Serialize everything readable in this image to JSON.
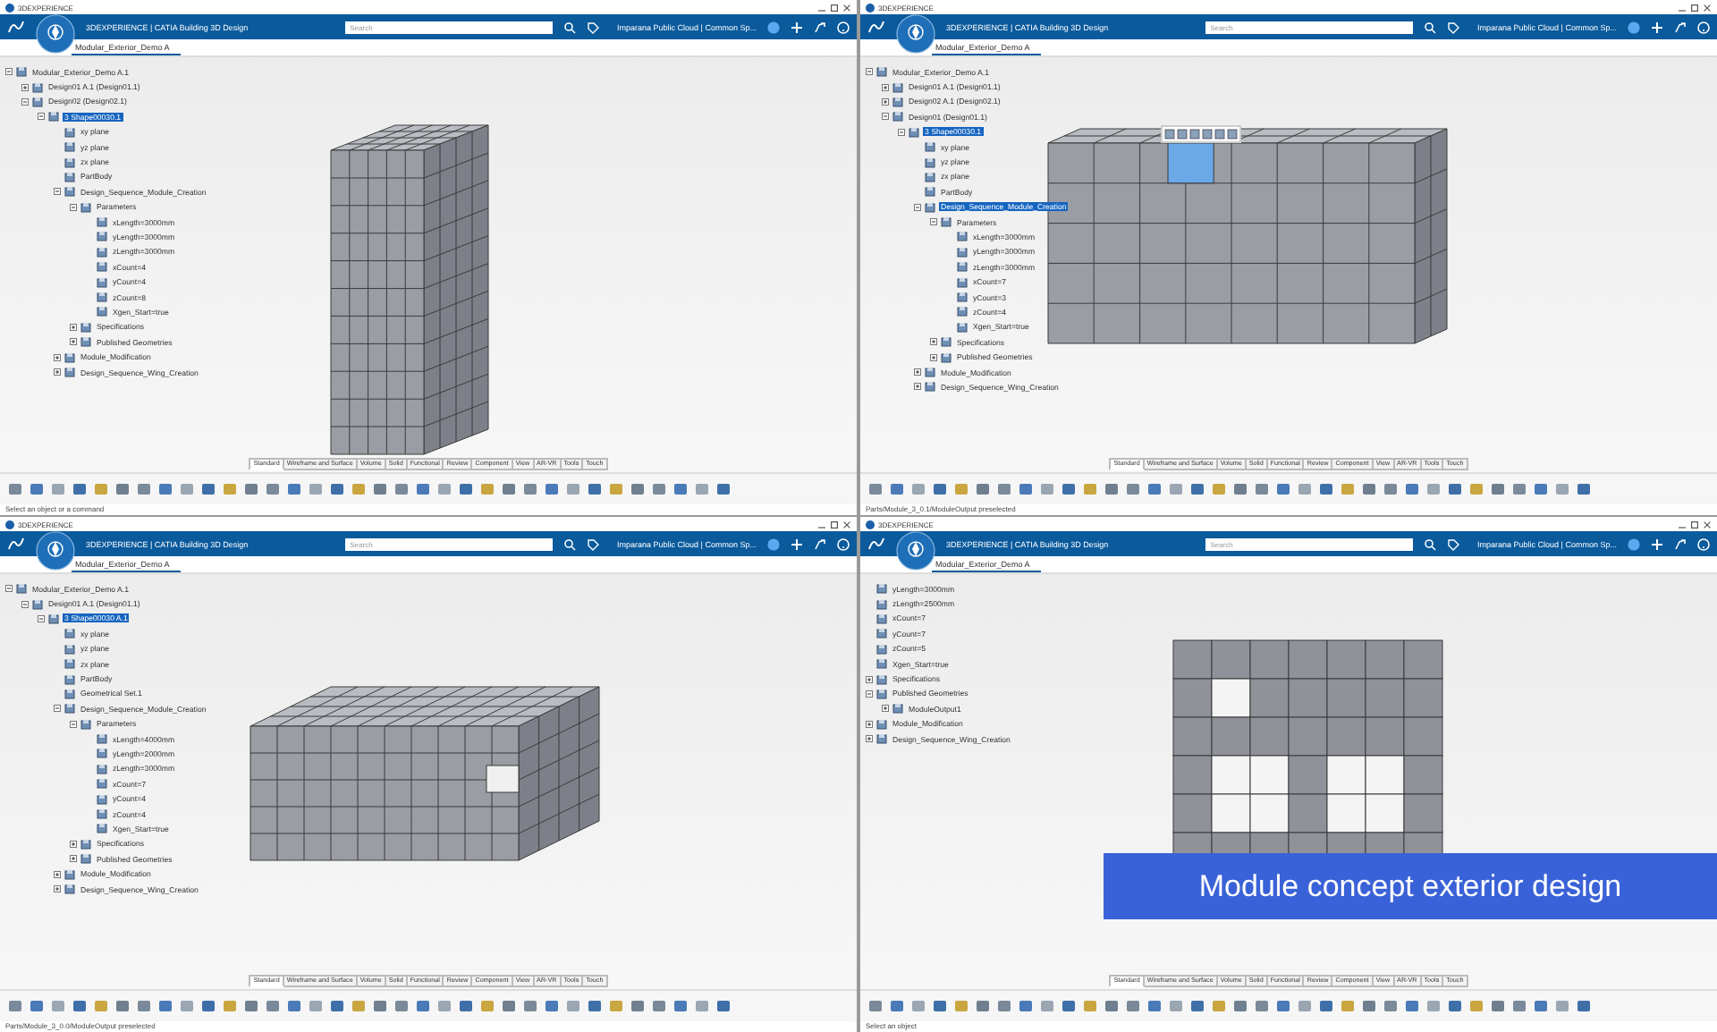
{
  "panes": [
    {
      "window_title": "3DEXPERIENCE",
      "app_title": "3DEXPERIENCE | CATIA Building 3D Design",
      "search": {
        "placeholder": "Search"
      },
      "cloud": "Imparana Public Cloud | Common Sp...",
      "doc_tab": "Modular_Exterior_Demo A",
      "model": {
        "kind": "tower"
      },
      "status": "Select an object or a command",
      "tree": [
        {
          "label": "Modular_Exterior_Demo A.1",
          "selected": false,
          "expanded": true,
          "children": [
            {
              "label": "Design01 A.1 (Design01.1)",
              "selected": false,
              "expanded": false
            },
            {
              "label": "Design02 (Design02.1)",
              "selected": false,
              "expanded": true,
              "children": [
                {
                  "label": "3 Shape00030.1",
                  "selected": true,
                  "expanded": true,
                  "children": [
                    {
                      "label": "xy plane",
                      "selected": false
                    },
                    {
                      "label": "yz plane",
                      "selected": false
                    },
                    {
                      "label": "zx plane",
                      "selected": false
                    },
                    {
                      "label": "PartBody",
                      "selected": false
                    },
                    {
                      "label": "Design_Sequence_Module_Creation",
                      "selected": false,
                      "expanded": true,
                      "children": [
                        {
                          "label": "Parameters",
                          "selected": false,
                          "expanded": true,
                          "children": [
                            {
                              "label": "xLength=3000mm",
                              "selected": false
                            },
                            {
                              "label": "yLength=3000mm",
                              "selected": false
                            },
                            {
                              "label": "zLength=3000mm",
                              "selected": false
                            },
                            {
                              "label": "xCount=4",
                              "selected": false
                            },
                            {
                              "label": "yCount=4",
                              "selected": false
                            },
                            {
                              "label": "zCount=8",
                              "selected": false
                            },
                            {
                              "label": "Xgen_Start=true",
                              "selected": false
                            }
                          ]
                        },
                        {
                          "label": "Specifications",
                          "selected": false,
                          "expanded": false
                        },
                        {
                          "label": "Published Geometries",
                          "selected": false,
                          "expanded": false
                        }
                      ]
                    },
                    {
                      "label": "Module_Modification",
                      "selected": false,
                      "expanded": false
                    },
                    {
                      "label": "Design_Sequence_Wing_Creation",
                      "selected": false,
                      "expanded": false
                    }
                  ]
                }
              ]
            }
          ]
        }
      ],
      "section_tabs": [
        {
          "label": "Standard",
          "selected": true
        },
        {
          "label": "Wireframe and Surface",
          "selected": false
        },
        {
          "label": "Volume",
          "selected": false
        },
        {
          "label": "Solid",
          "selected": false
        },
        {
          "label": "Functional",
          "selected": false
        },
        {
          "label": "Review",
          "selected": false
        },
        {
          "label": "Component",
          "selected": false
        },
        {
          "label": "View",
          "selected": false
        },
        {
          "label": "AR-VR",
          "selected": false
        },
        {
          "label": "Tools",
          "selected": false
        },
        {
          "label": "Touch",
          "selected": false
        }
      ]
    },
    {
      "window_title": "3DEXPERIENCE",
      "app_title": "3DEXPERIENCE | CATIA Building 3D Design",
      "search": {
        "placeholder": "Search"
      },
      "cloud": "Imparana Public Cloud | Common Sp...",
      "doc_tab": "Modular_Exterior_Demo A",
      "model": {
        "kind": "wall"
      },
      "status": "Parts/Module_3_0.1/ModuleOutput preselected",
      "tree": [
        {
          "label": "Modular_Exterior_Demo A.1",
          "selected": false,
          "expanded": true,
          "children": [
            {
              "label": "Design01 A.1 (Design01.1)",
              "selected": false,
              "expanded": false
            },
            {
              "label": "Design02 A.1 (Design02.1)",
              "selected": false,
              "expanded": false
            },
            {
              "label": "Design01 (Design01.1)",
              "selected": false,
              "expanded": true,
              "children": [
                {
                  "label": "3 Shape00030.1",
                  "selected": true,
                  "expanded": true,
                  "children": [
                    {
                      "label": "xy plane",
                      "selected": false
                    },
                    {
                      "label": "yz plane",
                      "selected": false
                    },
                    {
                      "label": "zx plane",
                      "selected": false
                    },
                    {
                      "label": "PartBody",
                      "selected": false
                    },
                    {
                      "label": "Design_Sequence_Module_Creation",
                      "selected": true,
                      "expanded": true,
                      "children": [
                        {
                          "label": "Parameters",
                          "selected": false,
                          "expanded": true,
                          "children": [
                            {
                              "label": "xLength=3000mm",
                              "selected": false
                            },
                            {
                              "label": "yLength=3000mm",
                              "selected": false
                            },
                            {
                              "label": "zLength=3000mm",
                              "selected": false
                            },
                            {
                              "label": "xCount=7",
                              "selected": false
                            },
                            {
                              "label": "yCount=3",
                              "selected": false
                            },
                            {
                              "label": "zCount=4",
                              "selected": false
                            },
                            {
                              "label": "Xgen_Start=true",
                              "selected": false
                            }
                          ]
                        },
                        {
                          "label": "Specifications",
                          "selected": false,
                          "expanded": false
                        },
                        {
                          "label": "Published Geometries",
                          "selected": false,
                          "expanded": false
                        }
                      ]
                    },
                    {
                      "label": "Module_Modification",
                      "selected": false,
                      "expanded": false
                    },
                    {
                      "label": "Design_Sequence_Wing_Creation",
                      "selected": false,
                      "expanded": false
                    }
                  ]
                }
              ]
            }
          ]
        }
      ],
      "section_tabs": [
        {
          "label": "Standard",
          "selected": true
        },
        {
          "label": "Wireframe and Surface",
          "selected": false
        },
        {
          "label": "Volume",
          "selected": false
        },
        {
          "label": "Solid",
          "selected": false
        },
        {
          "label": "Functional",
          "selected": false
        },
        {
          "label": "Review",
          "selected": false
        },
        {
          "label": "Component",
          "selected": false
        },
        {
          "label": "View",
          "selected": false
        },
        {
          "label": "AR-VR",
          "selected": false
        },
        {
          "label": "Tools",
          "selected": false
        },
        {
          "label": "Touch",
          "selected": false
        }
      ]
    },
    {
      "window_title": "3DEXPERIENCE",
      "app_title": "3DEXPERIENCE | CATIA Building 3D Design",
      "search": {
        "placeholder": "Search"
      },
      "cloud": "Imparana Public Cloud | Common Sp...",
      "doc_tab": "Modular_Exterior_Demo A",
      "model": {
        "kind": "block"
      },
      "status": "Parts/Module_3_0.0/ModuleOutput preselected",
      "tree": [
        {
          "label": "Modular_Exterior_Demo A.1",
          "selected": false,
          "expanded": true,
          "children": [
            {
              "label": "Design01 A.1 (Design01.1)",
              "selected": false,
              "expanded": true,
              "children": [
                {
                  "label": "3 Shape00030 A.1",
                  "selected": true,
                  "expanded": true,
                  "children": [
                    {
                      "label": "xy plane",
                      "selected": false
                    },
                    {
                      "label": "yz plane",
                      "selected": false
                    },
                    {
                      "label": "zx plane",
                      "selected": false
                    },
                    {
                      "label": "PartBody",
                      "selected": false
                    },
                    {
                      "label": "Geometrical Set.1",
                      "selected": false
                    },
                    {
                      "label": "Design_Sequence_Module_Creation",
                      "selected": false,
                      "expanded": true,
                      "children": [
                        {
                          "label": "Parameters",
                          "selected": false,
                          "expanded": true,
                          "children": [
                            {
                              "label": "xLength=4000mm",
                              "selected": false
                            },
                            {
                              "label": "yLength=2000mm",
                              "selected": false
                            },
                            {
                              "label": "zLength=3000mm",
                              "selected": false
                            },
                            {
                              "label": "xCount=7",
                              "selected": false
                            },
                            {
                              "label": "yCount=4",
                              "selected": false
                            },
                            {
                              "label": "zCount=4",
                              "selected": false
                            },
                            {
                              "label": "Xgen_Start=true",
                              "selected": false
                            }
                          ]
                        },
                        {
                          "label": "Specifications",
                          "selected": false,
                          "expanded": false
                        },
                        {
                          "label": "Published Geometries",
                          "selected": false,
                          "expanded": false
                        }
                      ]
                    },
                    {
                      "label": "Module_Modification",
                      "selected": false,
                      "expanded": false
                    },
                    {
                      "label": "Design_Sequence_Wing_Creation",
                      "selected": false,
                      "expanded": false
                    }
                  ]
                }
              ]
            }
          ]
        }
      ],
      "section_tabs": [
        {
          "label": "Standard",
          "selected": true
        },
        {
          "label": "Wireframe and Surface",
          "selected": false
        },
        {
          "label": "Volume",
          "selected": false
        },
        {
          "label": "Solid",
          "selected": false
        },
        {
          "label": "Functional",
          "selected": false
        },
        {
          "label": "Review",
          "selected": false
        },
        {
          "label": "Component",
          "selected": false
        },
        {
          "label": "View",
          "selected": false
        },
        {
          "label": "AR-VR",
          "selected": false
        },
        {
          "label": "Tools",
          "selected": false
        },
        {
          "label": "Touch",
          "selected": false
        }
      ]
    },
    {
      "window_title": "3DEXPERIENCE",
      "app_title": "3DEXPERIENCE | CATIA Building 3D Design",
      "search": {
        "placeholder": "Search"
      },
      "cloud": "Imparana Public Cloud | Common Sp...",
      "doc_tab": "Modular_Exterior_Demo A",
      "model": {
        "kind": "elevation"
      },
      "status": "Select an object",
      "tree": [
        {
          "label": "yLength=3000mm",
          "selected": false
        },
        {
          "label": "zLength=2500mm",
          "selected": false
        },
        {
          "label": "xCount=7",
          "selected": false
        },
        {
          "label": "yCount=7",
          "selected": false
        },
        {
          "label": "zCount=5",
          "selected": false
        },
        {
          "label": "Xgen_Start=true",
          "selected": false
        },
        {
          "label": "Specifications",
          "selected": false,
          "expanded": false
        },
        {
          "label": "Published Geometries",
          "selected": false,
          "expanded": true,
          "children": [
            {
              "label": "ModuleOutput1",
              "selected": false,
              "expanded": false
            }
          ]
        },
        {
          "label": "Module_Modification",
          "selected": false,
          "expanded": false
        },
        {
          "label": "Design_Sequence_Wing_Creation",
          "selected": false,
          "expanded": false
        }
      ],
      "section_tabs": [
        {
          "label": "Standard",
          "selected": true
        },
        {
          "label": "Wireframe and Surface",
          "selected": false
        },
        {
          "label": "Volume",
          "selected": false
        },
        {
          "label": "Solid",
          "selected": false
        },
        {
          "label": "Functional",
          "selected": false
        },
        {
          "label": "Review",
          "selected": false
        },
        {
          "label": "Component",
          "selected": false
        },
        {
          "label": "View",
          "selected": false
        },
        {
          "label": "AR-VR",
          "selected": false
        },
        {
          "label": "Tools",
          "selected": false
        },
        {
          "label": "Touch",
          "selected": false
        }
      ]
    }
  ],
  "caption": "Module concept exterior design"
}
